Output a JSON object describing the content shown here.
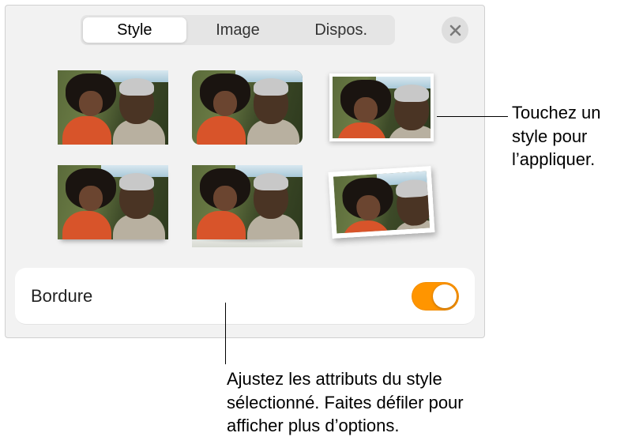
{
  "tabs": {
    "style": "Style",
    "image": "Image",
    "dispos": "Dispos."
  },
  "border": {
    "label": "Bordure",
    "on": true
  },
  "callouts": {
    "right": "Touchez un style pour l’appliquer.",
    "bottom": "Ajustez les attributs du style sélectionné. Faites défiler pour afficher plus d’options."
  },
  "colors": {
    "accent": "#ff9500"
  },
  "icons": {
    "close": "close-icon"
  }
}
